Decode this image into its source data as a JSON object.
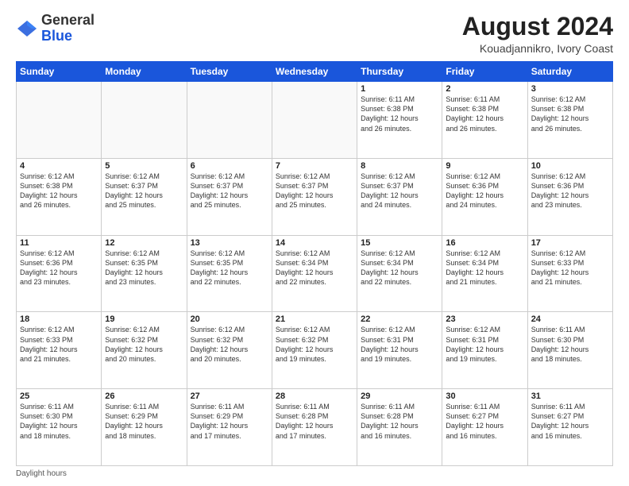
{
  "logo": {
    "general": "General",
    "blue": "Blue"
  },
  "title": "August 2024",
  "location": "Kouadjannikro, Ivory Coast",
  "days_header": [
    "Sunday",
    "Monday",
    "Tuesday",
    "Wednesday",
    "Thursday",
    "Friday",
    "Saturday"
  ],
  "footer": "Daylight hours",
  "weeks": [
    [
      {
        "day": "",
        "info": ""
      },
      {
        "day": "",
        "info": ""
      },
      {
        "day": "",
        "info": ""
      },
      {
        "day": "",
        "info": ""
      },
      {
        "day": "1",
        "info": "Sunrise: 6:11 AM\nSunset: 6:38 PM\nDaylight: 12 hours\nand 26 minutes."
      },
      {
        "day": "2",
        "info": "Sunrise: 6:11 AM\nSunset: 6:38 PM\nDaylight: 12 hours\nand 26 minutes."
      },
      {
        "day": "3",
        "info": "Sunrise: 6:12 AM\nSunset: 6:38 PM\nDaylight: 12 hours\nand 26 minutes."
      }
    ],
    [
      {
        "day": "4",
        "info": "Sunrise: 6:12 AM\nSunset: 6:38 PM\nDaylight: 12 hours\nand 26 minutes."
      },
      {
        "day": "5",
        "info": "Sunrise: 6:12 AM\nSunset: 6:37 PM\nDaylight: 12 hours\nand 25 minutes."
      },
      {
        "day": "6",
        "info": "Sunrise: 6:12 AM\nSunset: 6:37 PM\nDaylight: 12 hours\nand 25 minutes."
      },
      {
        "day": "7",
        "info": "Sunrise: 6:12 AM\nSunset: 6:37 PM\nDaylight: 12 hours\nand 25 minutes."
      },
      {
        "day": "8",
        "info": "Sunrise: 6:12 AM\nSunset: 6:37 PM\nDaylight: 12 hours\nand 24 minutes."
      },
      {
        "day": "9",
        "info": "Sunrise: 6:12 AM\nSunset: 6:36 PM\nDaylight: 12 hours\nand 24 minutes."
      },
      {
        "day": "10",
        "info": "Sunrise: 6:12 AM\nSunset: 6:36 PM\nDaylight: 12 hours\nand 23 minutes."
      }
    ],
    [
      {
        "day": "11",
        "info": "Sunrise: 6:12 AM\nSunset: 6:36 PM\nDaylight: 12 hours\nand 23 minutes."
      },
      {
        "day": "12",
        "info": "Sunrise: 6:12 AM\nSunset: 6:35 PM\nDaylight: 12 hours\nand 23 minutes."
      },
      {
        "day": "13",
        "info": "Sunrise: 6:12 AM\nSunset: 6:35 PM\nDaylight: 12 hours\nand 22 minutes."
      },
      {
        "day": "14",
        "info": "Sunrise: 6:12 AM\nSunset: 6:34 PM\nDaylight: 12 hours\nand 22 minutes."
      },
      {
        "day": "15",
        "info": "Sunrise: 6:12 AM\nSunset: 6:34 PM\nDaylight: 12 hours\nand 22 minutes."
      },
      {
        "day": "16",
        "info": "Sunrise: 6:12 AM\nSunset: 6:34 PM\nDaylight: 12 hours\nand 21 minutes."
      },
      {
        "day": "17",
        "info": "Sunrise: 6:12 AM\nSunset: 6:33 PM\nDaylight: 12 hours\nand 21 minutes."
      }
    ],
    [
      {
        "day": "18",
        "info": "Sunrise: 6:12 AM\nSunset: 6:33 PM\nDaylight: 12 hours\nand 21 minutes."
      },
      {
        "day": "19",
        "info": "Sunrise: 6:12 AM\nSunset: 6:32 PM\nDaylight: 12 hours\nand 20 minutes."
      },
      {
        "day": "20",
        "info": "Sunrise: 6:12 AM\nSunset: 6:32 PM\nDaylight: 12 hours\nand 20 minutes."
      },
      {
        "day": "21",
        "info": "Sunrise: 6:12 AM\nSunset: 6:32 PM\nDaylight: 12 hours\nand 19 minutes."
      },
      {
        "day": "22",
        "info": "Sunrise: 6:12 AM\nSunset: 6:31 PM\nDaylight: 12 hours\nand 19 minutes."
      },
      {
        "day": "23",
        "info": "Sunrise: 6:12 AM\nSunset: 6:31 PM\nDaylight: 12 hours\nand 19 minutes."
      },
      {
        "day": "24",
        "info": "Sunrise: 6:11 AM\nSunset: 6:30 PM\nDaylight: 12 hours\nand 18 minutes."
      }
    ],
    [
      {
        "day": "25",
        "info": "Sunrise: 6:11 AM\nSunset: 6:30 PM\nDaylight: 12 hours\nand 18 minutes."
      },
      {
        "day": "26",
        "info": "Sunrise: 6:11 AM\nSunset: 6:29 PM\nDaylight: 12 hours\nand 18 minutes."
      },
      {
        "day": "27",
        "info": "Sunrise: 6:11 AM\nSunset: 6:29 PM\nDaylight: 12 hours\nand 17 minutes."
      },
      {
        "day": "28",
        "info": "Sunrise: 6:11 AM\nSunset: 6:28 PM\nDaylight: 12 hours\nand 17 minutes."
      },
      {
        "day": "29",
        "info": "Sunrise: 6:11 AM\nSunset: 6:28 PM\nDaylight: 12 hours\nand 16 minutes."
      },
      {
        "day": "30",
        "info": "Sunrise: 6:11 AM\nSunset: 6:27 PM\nDaylight: 12 hours\nand 16 minutes."
      },
      {
        "day": "31",
        "info": "Sunrise: 6:11 AM\nSunset: 6:27 PM\nDaylight: 12 hours\nand 16 minutes."
      }
    ]
  ]
}
